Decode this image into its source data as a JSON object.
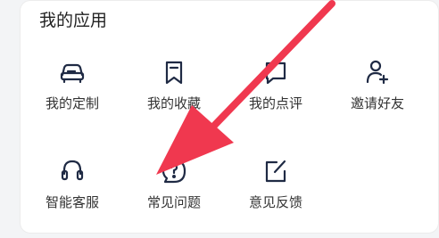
{
  "section": {
    "title": "我的应用"
  },
  "apps": [
    {
      "label": "我的定制",
      "icon": "car-edit-icon"
    },
    {
      "label": "我的收藏",
      "icon": "bookmark-icon"
    },
    {
      "label": "我的点评",
      "icon": "comment-icon"
    },
    {
      "label": "邀请好友",
      "icon": "add-user-icon"
    },
    {
      "label": "智能客服",
      "icon": "headset-icon"
    },
    {
      "label": "常见问题",
      "icon": "question-bubble-icon"
    },
    {
      "label": "意见反馈",
      "icon": "feedback-edit-icon"
    }
  ],
  "colors": {
    "icon": "#1f2a44",
    "annotation_arrow": "#f0384f"
  }
}
